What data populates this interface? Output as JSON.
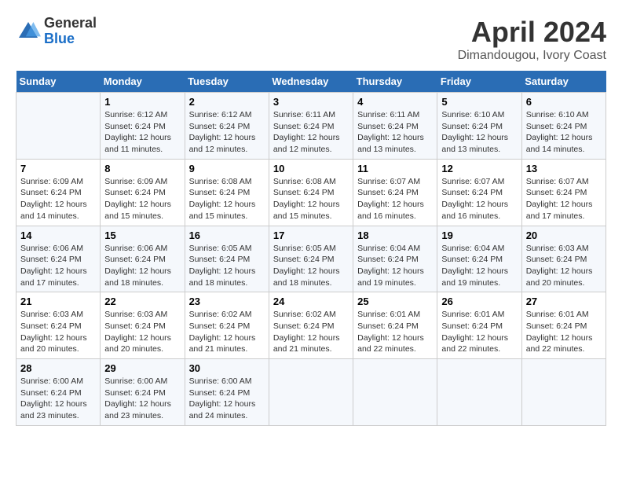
{
  "logo": {
    "general": "General",
    "blue": "Blue"
  },
  "title": "April 2024",
  "subtitle": "Dimandougou, Ivory Coast",
  "days_of_week": [
    "Sunday",
    "Monday",
    "Tuesday",
    "Wednesday",
    "Thursday",
    "Friday",
    "Saturday"
  ],
  "weeks": [
    [
      {
        "num": "",
        "sunrise": "",
        "sunset": "",
        "daylight": ""
      },
      {
        "num": "1",
        "sunrise": "Sunrise: 6:12 AM",
        "sunset": "Sunset: 6:24 PM",
        "daylight": "Daylight: 12 hours and 11 minutes."
      },
      {
        "num": "2",
        "sunrise": "Sunrise: 6:12 AM",
        "sunset": "Sunset: 6:24 PM",
        "daylight": "Daylight: 12 hours and 12 minutes."
      },
      {
        "num": "3",
        "sunrise": "Sunrise: 6:11 AM",
        "sunset": "Sunset: 6:24 PM",
        "daylight": "Daylight: 12 hours and 12 minutes."
      },
      {
        "num": "4",
        "sunrise": "Sunrise: 6:11 AM",
        "sunset": "Sunset: 6:24 PM",
        "daylight": "Daylight: 12 hours and 13 minutes."
      },
      {
        "num": "5",
        "sunrise": "Sunrise: 6:10 AM",
        "sunset": "Sunset: 6:24 PM",
        "daylight": "Daylight: 12 hours and 13 minutes."
      },
      {
        "num": "6",
        "sunrise": "Sunrise: 6:10 AM",
        "sunset": "Sunset: 6:24 PM",
        "daylight": "Daylight: 12 hours and 14 minutes."
      }
    ],
    [
      {
        "num": "7",
        "sunrise": "Sunrise: 6:09 AM",
        "sunset": "Sunset: 6:24 PM",
        "daylight": "Daylight: 12 hours and 14 minutes."
      },
      {
        "num": "8",
        "sunrise": "Sunrise: 6:09 AM",
        "sunset": "Sunset: 6:24 PM",
        "daylight": "Daylight: 12 hours and 15 minutes."
      },
      {
        "num": "9",
        "sunrise": "Sunrise: 6:08 AM",
        "sunset": "Sunset: 6:24 PM",
        "daylight": "Daylight: 12 hours and 15 minutes."
      },
      {
        "num": "10",
        "sunrise": "Sunrise: 6:08 AM",
        "sunset": "Sunset: 6:24 PM",
        "daylight": "Daylight: 12 hours and 15 minutes."
      },
      {
        "num": "11",
        "sunrise": "Sunrise: 6:07 AM",
        "sunset": "Sunset: 6:24 PM",
        "daylight": "Daylight: 12 hours and 16 minutes."
      },
      {
        "num": "12",
        "sunrise": "Sunrise: 6:07 AM",
        "sunset": "Sunset: 6:24 PM",
        "daylight": "Daylight: 12 hours and 16 minutes."
      },
      {
        "num": "13",
        "sunrise": "Sunrise: 6:07 AM",
        "sunset": "Sunset: 6:24 PM",
        "daylight": "Daylight: 12 hours and 17 minutes."
      }
    ],
    [
      {
        "num": "14",
        "sunrise": "Sunrise: 6:06 AM",
        "sunset": "Sunset: 6:24 PM",
        "daylight": "Daylight: 12 hours and 17 minutes."
      },
      {
        "num": "15",
        "sunrise": "Sunrise: 6:06 AM",
        "sunset": "Sunset: 6:24 PM",
        "daylight": "Daylight: 12 hours and 18 minutes."
      },
      {
        "num": "16",
        "sunrise": "Sunrise: 6:05 AM",
        "sunset": "Sunset: 6:24 PM",
        "daylight": "Daylight: 12 hours and 18 minutes."
      },
      {
        "num": "17",
        "sunrise": "Sunrise: 6:05 AM",
        "sunset": "Sunset: 6:24 PM",
        "daylight": "Daylight: 12 hours and 18 minutes."
      },
      {
        "num": "18",
        "sunrise": "Sunrise: 6:04 AM",
        "sunset": "Sunset: 6:24 PM",
        "daylight": "Daylight: 12 hours and 19 minutes."
      },
      {
        "num": "19",
        "sunrise": "Sunrise: 6:04 AM",
        "sunset": "Sunset: 6:24 PM",
        "daylight": "Daylight: 12 hours and 19 minutes."
      },
      {
        "num": "20",
        "sunrise": "Sunrise: 6:03 AM",
        "sunset": "Sunset: 6:24 PM",
        "daylight": "Daylight: 12 hours and 20 minutes."
      }
    ],
    [
      {
        "num": "21",
        "sunrise": "Sunrise: 6:03 AM",
        "sunset": "Sunset: 6:24 PM",
        "daylight": "Daylight: 12 hours and 20 minutes."
      },
      {
        "num": "22",
        "sunrise": "Sunrise: 6:03 AM",
        "sunset": "Sunset: 6:24 PM",
        "daylight": "Daylight: 12 hours and 20 minutes."
      },
      {
        "num": "23",
        "sunrise": "Sunrise: 6:02 AM",
        "sunset": "Sunset: 6:24 PM",
        "daylight": "Daylight: 12 hours and 21 minutes."
      },
      {
        "num": "24",
        "sunrise": "Sunrise: 6:02 AM",
        "sunset": "Sunset: 6:24 PM",
        "daylight": "Daylight: 12 hours and 21 minutes."
      },
      {
        "num": "25",
        "sunrise": "Sunrise: 6:01 AM",
        "sunset": "Sunset: 6:24 PM",
        "daylight": "Daylight: 12 hours and 22 minutes."
      },
      {
        "num": "26",
        "sunrise": "Sunrise: 6:01 AM",
        "sunset": "Sunset: 6:24 PM",
        "daylight": "Daylight: 12 hours and 22 minutes."
      },
      {
        "num": "27",
        "sunrise": "Sunrise: 6:01 AM",
        "sunset": "Sunset: 6:24 PM",
        "daylight": "Daylight: 12 hours and 22 minutes."
      }
    ],
    [
      {
        "num": "28",
        "sunrise": "Sunrise: 6:00 AM",
        "sunset": "Sunset: 6:24 PM",
        "daylight": "Daylight: 12 hours and 23 minutes."
      },
      {
        "num": "29",
        "sunrise": "Sunrise: 6:00 AM",
        "sunset": "Sunset: 6:24 PM",
        "daylight": "Daylight: 12 hours and 23 minutes."
      },
      {
        "num": "30",
        "sunrise": "Sunrise: 6:00 AM",
        "sunset": "Sunset: 6:24 PM",
        "daylight": "Daylight: 12 hours and 24 minutes."
      },
      {
        "num": "",
        "sunrise": "",
        "sunset": "",
        "daylight": ""
      },
      {
        "num": "",
        "sunrise": "",
        "sunset": "",
        "daylight": ""
      },
      {
        "num": "",
        "sunrise": "",
        "sunset": "",
        "daylight": ""
      },
      {
        "num": "",
        "sunrise": "",
        "sunset": "",
        "daylight": ""
      }
    ]
  ]
}
